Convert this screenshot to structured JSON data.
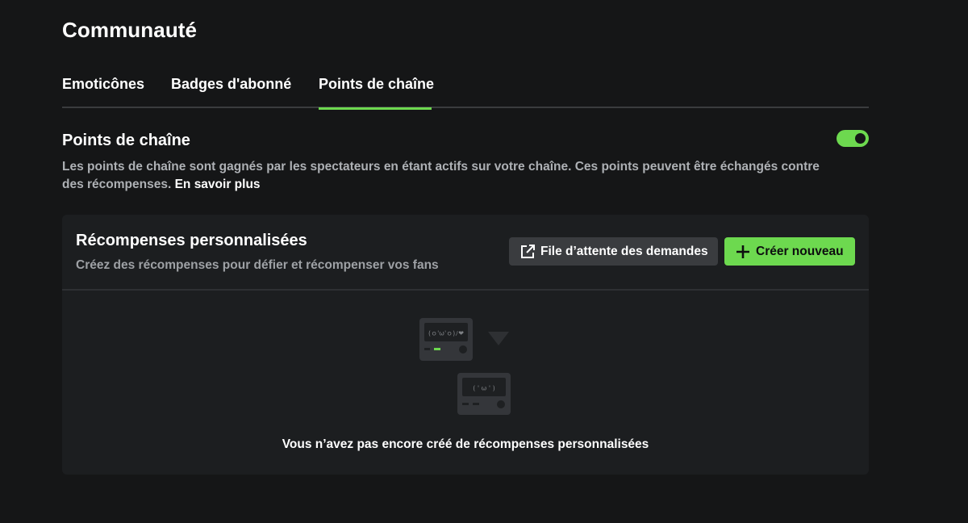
{
  "page": {
    "title": "Communauté"
  },
  "tabs": [
    {
      "label": "Emoticônes"
    },
    {
      "label": "Badges d'abonné"
    },
    {
      "label": "Points de chaîne",
      "active": true
    }
  ],
  "section": {
    "title": "Points de chaîne",
    "toggle_enabled": true,
    "description": "Les points de chaîne sont gagnés par les spectateurs en étant actifs sur votre chaîne. Ces points peuvent être échangés contre des récompenses.",
    "learn_more_label": "En savoir plus"
  },
  "rewards": {
    "title": "Récompenses personnalisées",
    "subtitle": "Créez des récompenses pour défier et récompenser vos fans",
    "queue_button_label": "File d’attente des demandes",
    "create_button_label": "Créer nouveau",
    "empty_state": {
      "screen_top_text": "(ｏ'ω'ｏ)ﾉ❤",
      "screen_bottom_text": "( ' ω ' )",
      "message": "Vous n’avez pas encore créé de récompenses personnalisées"
    }
  },
  "colors": {
    "accent": "#6dd94f",
    "background": "#151617",
    "panel": "#1c1e20"
  },
  "icons": {
    "queue": "external-link-icon",
    "create": "plus-icon"
  }
}
